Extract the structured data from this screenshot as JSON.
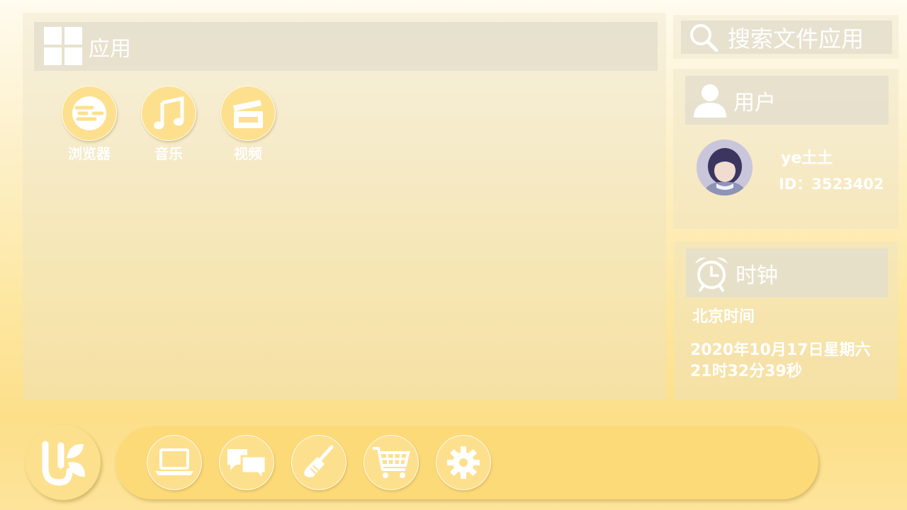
{
  "apps_section": {
    "title": "应用",
    "apps": [
      {
        "label": "浏览器",
        "icon": "browser-icon"
      },
      {
        "label": "音乐",
        "icon": "music-note-icon"
      },
      {
        "label": "视频",
        "icon": "clapperboard-icon"
      }
    ]
  },
  "search": {
    "placeholder": "搜索文件应用"
  },
  "user": {
    "title": "用户",
    "name": "ye土土",
    "id_text": "ID：3523402"
  },
  "clock": {
    "title": "时钟",
    "timezone_label": "北京时间",
    "date_text": "2020年10月17日星期六",
    "time_text": "21时32分39秒"
  },
  "dock": {
    "logo_icon": "uk-logo-icon",
    "items": [
      {
        "icon": "laptop-icon"
      },
      {
        "icon": "chat-icon"
      },
      {
        "icon": "broom-icon"
      },
      {
        "icon": "cart-icon"
      },
      {
        "icon": "gear-icon"
      }
    ]
  },
  "colors": {
    "accent": "#fde08e",
    "dock": "#fdda78",
    "text": "#ffffff"
  }
}
